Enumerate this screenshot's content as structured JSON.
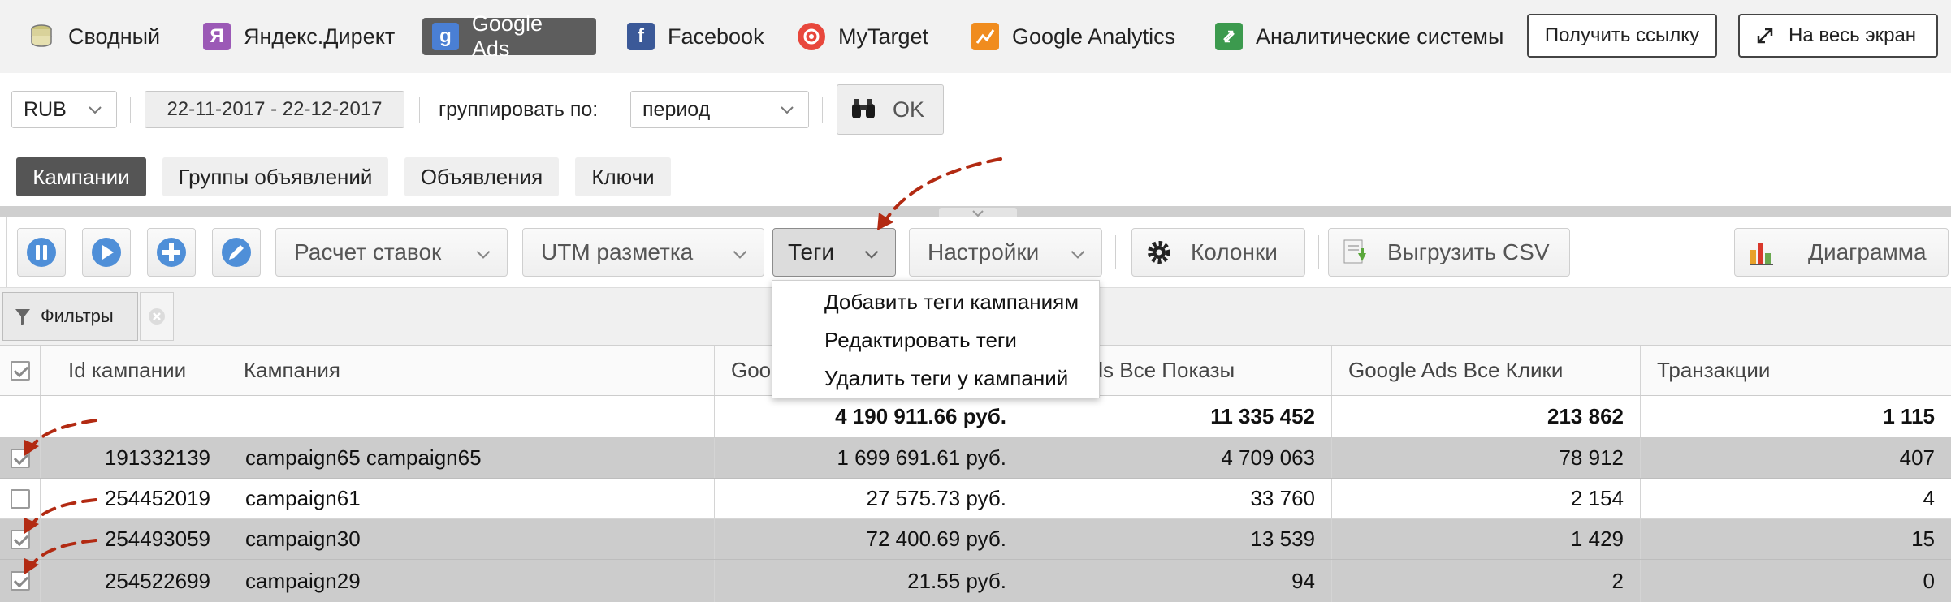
{
  "topnav": {
    "items": [
      {
        "label": "Сводный",
        "icon": "stack-icon"
      },
      {
        "label": "Яндекс.Директ",
        "icon": "yandex-icon"
      },
      {
        "label": "Google Ads",
        "icon": "google-ads-icon"
      },
      {
        "label": "Facebook",
        "icon": "facebook-icon"
      },
      {
        "label": "MyTarget",
        "icon": "mytarget-icon"
      },
      {
        "label": "Google Analytics",
        "icon": "google-analytics-icon"
      },
      {
        "label": "Аналитические системы",
        "icon": "analytics-systems-icon"
      }
    ],
    "active": "Google Ads",
    "get_link": "Получить ссылку",
    "fullscreen": "На весь экран"
  },
  "filters": {
    "currency": "RUB",
    "date_range": "22-11-2017 - 22-12-2017",
    "group_by_label": "группировать по:",
    "group_by_value": "период",
    "ok": "OK"
  },
  "levels": {
    "items": [
      "Кампании",
      "Группы объявлений",
      "Объявления",
      "Ключи"
    ],
    "active": "Кампании"
  },
  "toolbar": {
    "bid_calc": "Расчет ставок",
    "utm": "UTM разметка",
    "tags": "Теги",
    "settings": "Настройки",
    "columns": "Колонки",
    "export_csv": "Выгрузить CSV",
    "chart": "Диаграмма"
  },
  "tags_menu": {
    "items": [
      "Добавить теги кампаниям",
      "Редактировать теги",
      "Удалить теги у кампаний"
    ]
  },
  "filters_bar": {
    "label": "Фильтры"
  },
  "table": {
    "headers": {
      "id": "Id кампании",
      "campaign": "Кампания",
      "cost": "Goo",
      "impressions": "e Ads Все Показы",
      "clicks": "Google Ads Все Клики",
      "transactions": "Транзакции"
    },
    "totals": {
      "cost": "4 190 911.66 руб.",
      "impressions": "11 335 452",
      "clicks": "213 862",
      "transactions": "1 115"
    },
    "rows": [
      {
        "checked": true,
        "id": "191332139",
        "campaign": "campaign65 campaign65",
        "cost": "1 699 691.61 руб.",
        "impressions": "4 709 063",
        "clicks": "78 912",
        "transactions": "407"
      },
      {
        "checked": false,
        "id": "254452019",
        "campaign": "campaign61",
        "cost": "27 575.73 руб.",
        "impressions": "33 760",
        "clicks": "2 154",
        "transactions": "4"
      },
      {
        "checked": true,
        "id": "254493059",
        "campaign": "campaign30",
        "cost": "72 400.69 руб.",
        "impressions": "13 539",
        "clicks": "1 429",
        "transactions": "15"
      },
      {
        "checked": true,
        "id": "254522699",
        "campaign": "campaign29",
        "cost": "21.55 руб.",
        "impressions": "94",
        "clicks": "2",
        "transactions": "0"
      }
    ]
  },
  "colors": {
    "active_tab": "#5d5d5d",
    "selected_row": "#cccccc",
    "annotation_arrow": "#b22a12"
  }
}
